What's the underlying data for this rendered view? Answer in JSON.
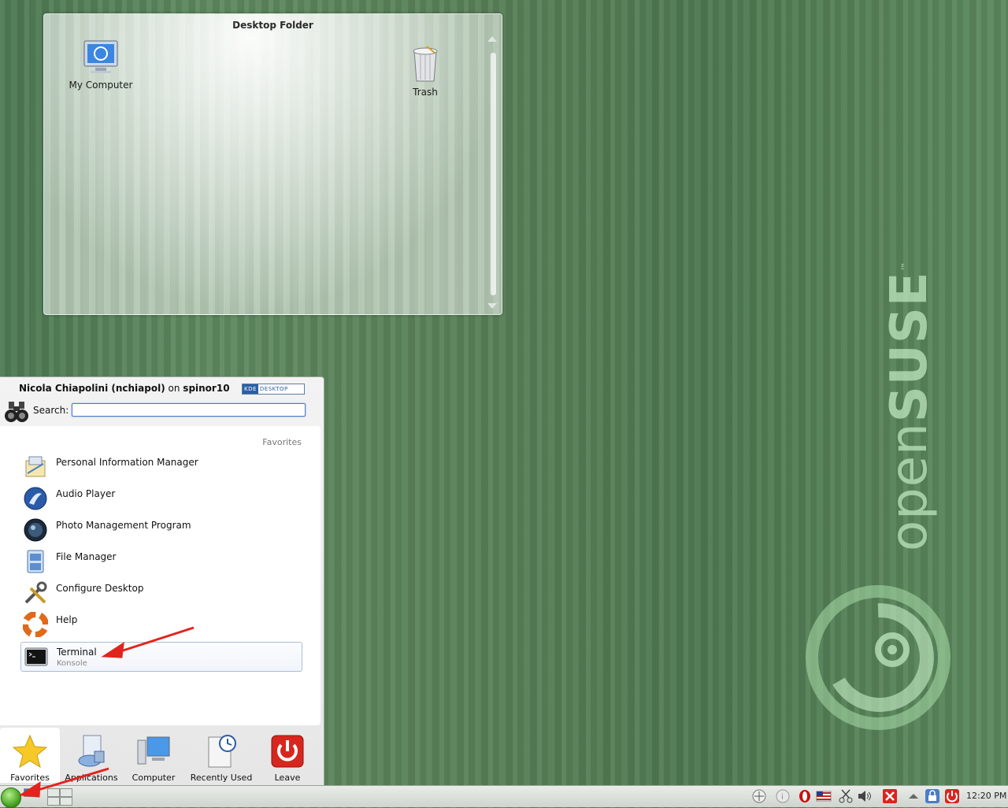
{
  "wallpaper": {
    "brand_light": "open",
    "brand_bold": "SUSE",
    "trademark": "™"
  },
  "desktop_folder": {
    "title": "Desktop Folder",
    "icons": [
      {
        "label": "My Computer",
        "icon": "computer-icon"
      },
      {
        "label": "Trash",
        "icon": "trash-icon"
      }
    ]
  },
  "kickoff": {
    "user_name": "Nicola Chiapolini (nchiapol)",
    "on_word": "on",
    "host": "spinor10",
    "badge": {
      "left": "KDE",
      "right": "DESKTOP"
    },
    "search_label": "Search:",
    "search_value": "",
    "section_title": "Favorites",
    "favorites": [
      {
        "label": "Personal Information Manager",
        "icon": "pim-icon"
      },
      {
        "label": "Audio Player",
        "icon": "audio-player-icon"
      },
      {
        "label": "Photo Management Program",
        "icon": "photo-icon"
      },
      {
        "label": "File Manager",
        "icon": "file-manager-icon"
      },
      {
        "label": "Configure Desktop",
        "icon": "configure-icon"
      },
      {
        "label": "Help",
        "icon": "help-icon"
      },
      {
        "label": "Terminal",
        "sublabel": "Konsole",
        "icon": "terminal-icon"
      }
    ],
    "tabs": [
      {
        "label": "Favorites",
        "icon": "star-icon"
      },
      {
        "label": "Applications",
        "icon": "applications-icon"
      },
      {
        "label": "Computer",
        "icon": "computer-icon"
      },
      {
        "label": "Recently Used",
        "icon": "clock-icon"
      },
      {
        "label": "Leave",
        "icon": "power-icon"
      }
    ]
  },
  "panel": {
    "clock": "12:20 PM"
  },
  "colors": {
    "accent_red": "#e3231e",
    "selection_border": "#aabfd8"
  }
}
